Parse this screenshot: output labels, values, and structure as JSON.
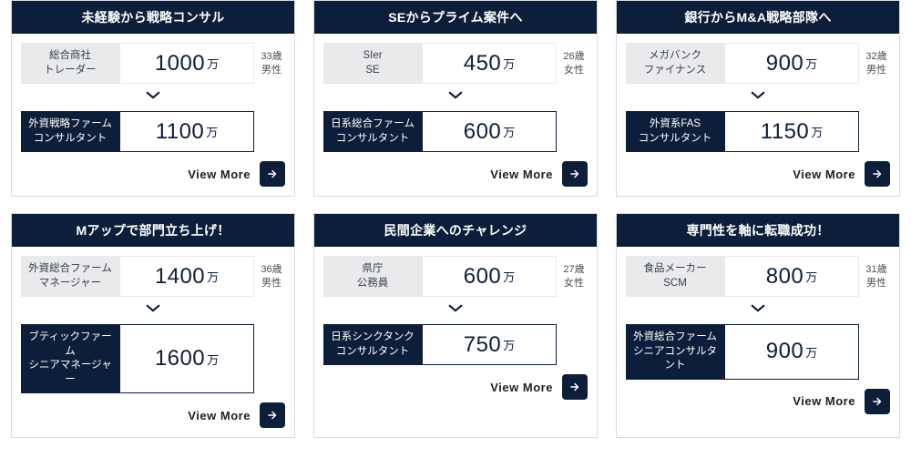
{
  "view_more_label": "View More",
  "cards": [
    {
      "title": "未経験から戦略コンサル",
      "before": {
        "job_line1": "総合商社",
        "job_line2": "トレーダー",
        "salary": "1000",
        "unit": "万",
        "age": "33歳",
        "gender": "男性"
      },
      "after": {
        "job_line1": "外資戦略ファーム",
        "job_line2": "コンサルタント",
        "salary": "1100",
        "unit": "万"
      }
    },
    {
      "title": "SEからプライム案件へ",
      "before": {
        "job_line1": "SIer",
        "job_line2": "SE",
        "salary": "450",
        "unit": "万",
        "age": "26歳",
        "gender": "女性"
      },
      "after": {
        "job_line1": "日系総合ファーム",
        "job_line2": "コンサルタント",
        "salary": "600",
        "unit": "万"
      }
    },
    {
      "title": "銀行からM&A戦略部隊へ",
      "before": {
        "job_line1": "メガバンク",
        "job_line2": "ファイナンス",
        "salary": "900",
        "unit": "万",
        "age": "32歳",
        "gender": "男性"
      },
      "after": {
        "job_line1": "外資系FAS",
        "job_line2": "コンサルタント",
        "salary": "1150",
        "unit": "万"
      }
    },
    {
      "title": "Mアップで部門立ち上げ！",
      "before": {
        "job_line1": "外資総合ファーム",
        "job_line2": "マネージャー",
        "salary": "1400",
        "unit": "万",
        "age": "36歳",
        "gender": "男性"
      },
      "after": {
        "job_line1": "ブティックファーム",
        "job_line2": "シニアマネージャー",
        "salary": "1600",
        "unit": "万"
      }
    },
    {
      "title": "民間企業へのチャレンジ",
      "before": {
        "job_line1": "県庁",
        "job_line2": "公務員",
        "salary": "600",
        "unit": "万",
        "age": "27歳",
        "gender": "女性"
      },
      "after": {
        "job_line1": "日系シンクタンク",
        "job_line2": "コンサルタント",
        "salary": "750",
        "unit": "万"
      }
    },
    {
      "title": "専門性を軸に転職成功！",
      "before": {
        "job_line1": "食品メーカー",
        "job_line2": "SCM",
        "salary": "800",
        "unit": "万",
        "age": "31歳",
        "gender": "男性"
      },
      "after": {
        "job_line1": "外資総合ファーム",
        "job_line2": "シニアコンサルタント",
        "salary": "900",
        "unit": "万"
      }
    }
  ]
}
